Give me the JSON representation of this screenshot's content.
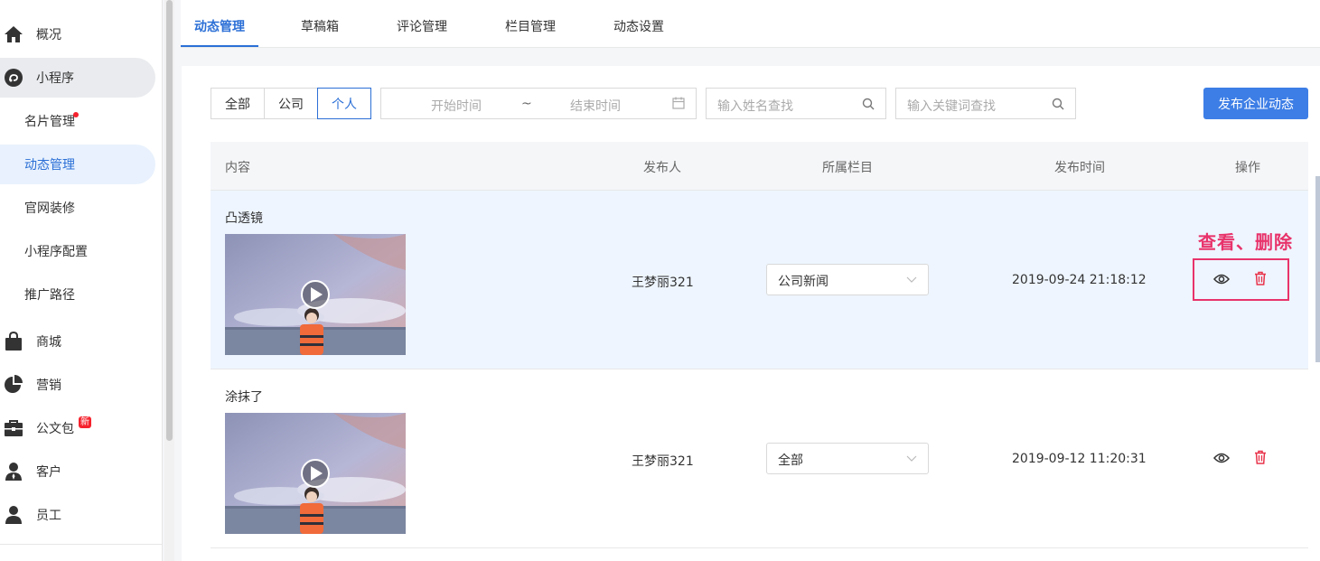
{
  "sidebar": {
    "items": [
      {
        "label": "概况",
        "icon": "home-icon"
      },
      {
        "label": "小程序",
        "icon": "mini-program-icon"
      },
      {
        "label": "名片管理"
      },
      {
        "label": "动态管理"
      },
      {
        "label": "官网装修"
      },
      {
        "label": "小程序配置"
      },
      {
        "label": "推广路径"
      },
      {
        "label": "商城",
        "icon": "shopping-bag-icon"
      },
      {
        "label": "营销",
        "icon": "pie-chart-icon"
      },
      {
        "label": "公文包",
        "icon": "briefcase-icon",
        "badge": "新"
      },
      {
        "label": "客户",
        "icon": "customer-icon"
      },
      {
        "label": "员工",
        "icon": "employee-icon"
      }
    ]
  },
  "tabs": [
    "动态管理",
    "草稿箱",
    "评论管理",
    "栏目管理",
    "动态设置"
  ],
  "filters": {
    "segments": [
      "全部",
      "公司",
      "个人"
    ],
    "start_placeholder": "开始时间",
    "range_sep": "~",
    "end_placeholder": "结束时间",
    "name_search_placeholder": "输入姓名查找",
    "keyword_search_placeholder": "输入关键词查找"
  },
  "publish_button": "发布企业动态",
  "table": {
    "headers": [
      "内容",
      "发布人",
      "所属栏目",
      "发布时间",
      "操作"
    ],
    "rows": [
      {
        "title": "凸透镜",
        "publisher": "王梦丽321",
        "column": "公司新闻",
        "time": "2019-09-24 21:18:12"
      },
      {
        "title": "涂抹了",
        "publisher": "王梦丽321",
        "column": "全部",
        "time": "2019-09-12 11:20:31"
      }
    ]
  },
  "annotation": "查看、删除",
  "colors": {
    "primary": "#2b6fd6",
    "button": "#3d7ee6",
    "annotation": "#e8336b",
    "delete": "#e8334a"
  }
}
